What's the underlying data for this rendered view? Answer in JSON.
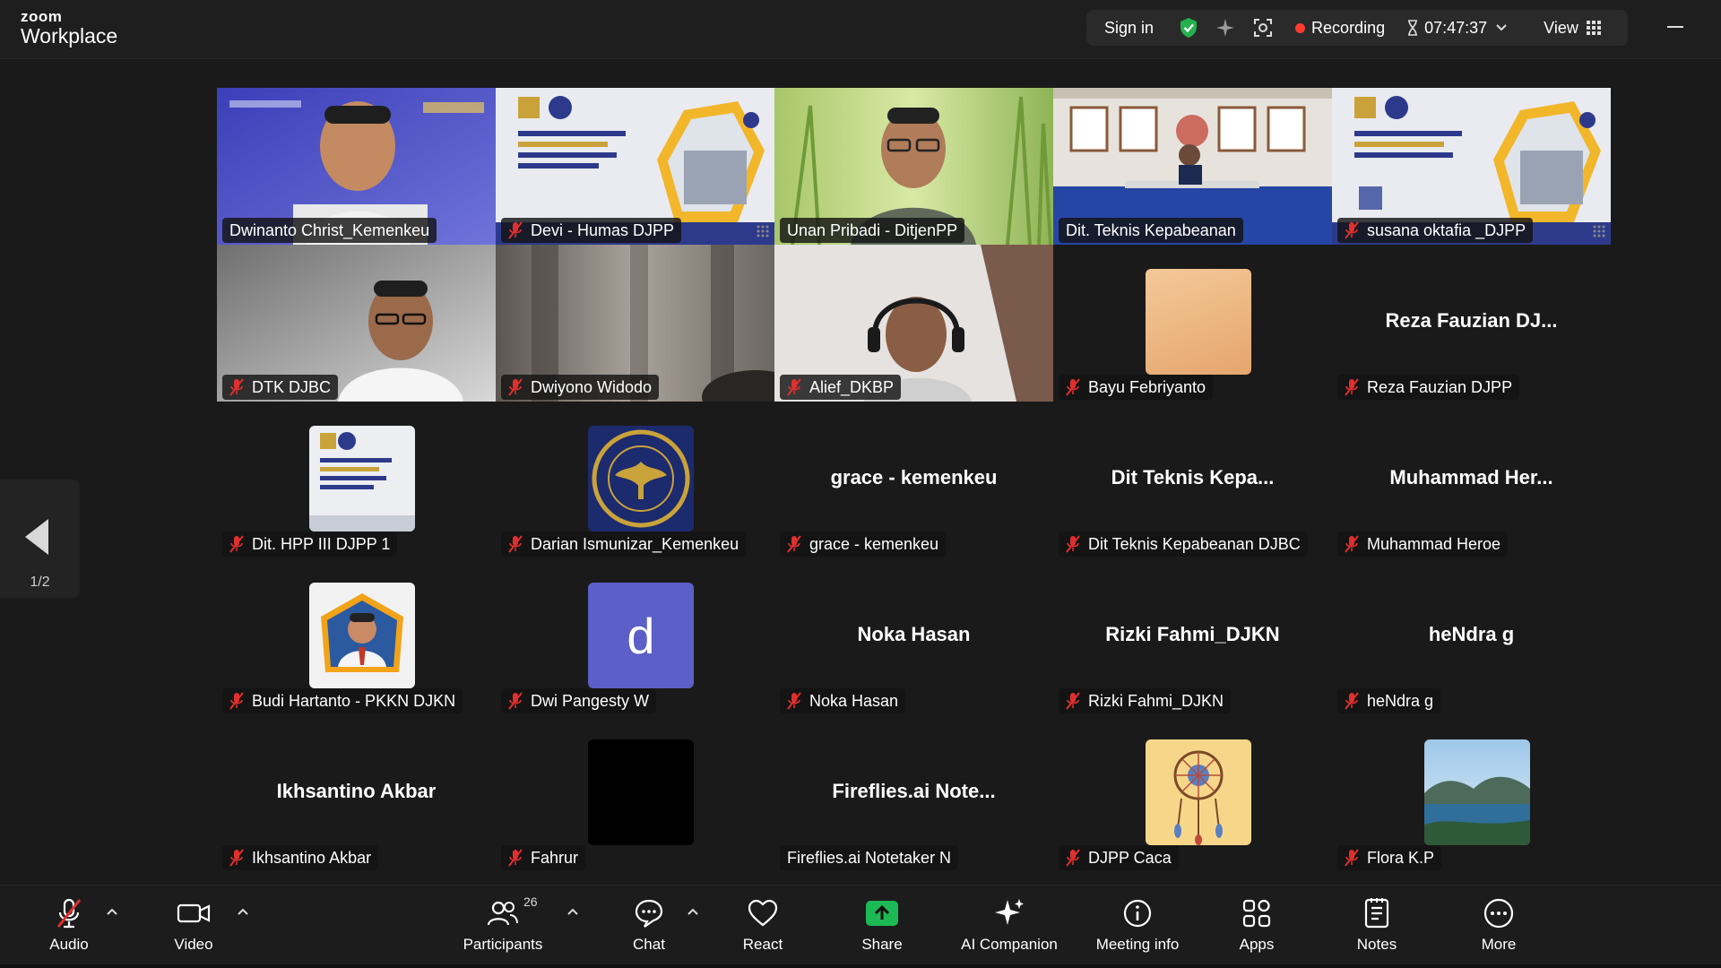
{
  "app": {
    "brand_top": "zoom",
    "brand_bottom": "Workplace"
  },
  "topbar": {
    "sign_in": "Sign in",
    "recording": "Recording",
    "timer": "07:47:37",
    "view": "View"
  },
  "pager": {
    "page": "1/2"
  },
  "colors": {
    "active_border": "#23d18b",
    "mic_off": "#e0302e",
    "recording_dot": "#ff3b30",
    "share_green": "#1db954"
  },
  "tiles": [
    {
      "name": "Dwinanto Christ_Kemenkeu",
      "muted": false,
      "active": true,
      "kind": "video"
    },
    {
      "name": "Devi - Humas DJPP",
      "muted": true,
      "kind": "video"
    },
    {
      "name": "Unan Pribadi - DitjenPP",
      "muted": false,
      "kind": "video"
    },
    {
      "name": "Dit. Teknis Kepabeanan",
      "muted": false,
      "kind": "video"
    },
    {
      "name": "susana oktafia _DJPP",
      "muted": true,
      "kind": "video"
    },
    {
      "name": "DTK DJBC",
      "muted": true,
      "kind": "video"
    },
    {
      "name": "Dwiyono Widodo",
      "muted": true,
      "kind": "video"
    },
    {
      "name": "Alief_DKBP",
      "muted": true,
      "kind": "video"
    },
    {
      "name": "Bayu Febriyanto",
      "muted": true,
      "kind": "avatar"
    },
    {
      "name": "Reza Fauzian DJPP",
      "display": "Reza Fauzian DJ...",
      "muted": true,
      "kind": "text"
    },
    {
      "name": "Dit. HPP III DJPP 1",
      "muted": true,
      "kind": "avatar"
    },
    {
      "name": "Darian Ismunizar_Kemenkeu",
      "muted": true,
      "kind": "avatar"
    },
    {
      "name": "grace - kemenkeu",
      "display": "grace - kemenkeu",
      "muted": true,
      "kind": "text"
    },
    {
      "name": "Dit Teknis Kepabeanan DJBC",
      "display": "Dit Teknis Kepa...",
      "muted": true,
      "kind": "text"
    },
    {
      "name": "Muhammad Heroe",
      "display": "Muhammad Her...",
      "muted": true,
      "kind": "text"
    },
    {
      "name": "Budi Hartanto - PKKN DJKN",
      "muted": true,
      "kind": "avatar"
    },
    {
      "name": "Dwi Pangesty W",
      "muted": true,
      "kind": "avatar",
      "letter": "d"
    },
    {
      "name": "Noka Hasan",
      "display": "Noka Hasan",
      "muted": true,
      "kind": "text"
    },
    {
      "name": "Rizki Fahmi_DJKN",
      "display": "Rizki Fahmi_DJKN",
      "muted": true,
      "kind": "text"
    },
    {
      "name": "heNdra g",
      "display": "heNdra g",
      "muted": true,
      "kind": "text"
    },
    {
      "name": "Ikhsantino Akbar",
      "display": "Ikhsantino Akbar",
      "muted": true,
      "kind": "text"
    },
    {
      "name": "Fahrur",
      "muted": true,
      "kind": "avatar"
    },
    {
      "name": "Fireflies.ai Notetaker N",
      "display": "Fireflies.ai Note...",
      "muted": false,
      "kind": "text"
    },
    {
      "name": "DJPP Caca",
      "muted": true,
      "kind": "avatar"
    },
    {
      "name": "Flora K.P",
      "muted": true,
      "kind": "avatar"
    }
  ],
  "toolbar": {
    "audio": "Audio",
    "video": "Video",
    "participants": "Participants",
    "participants_count": "26",
    "chat": "Chat",
    "react": "React",
    "share": "Share",
    "ai_companion": "AI Companion",
    "meeting_info": "Meeting info",
    "apps": "Apps",
    "notes": "Notes",
    "more": "More"
  }
}
